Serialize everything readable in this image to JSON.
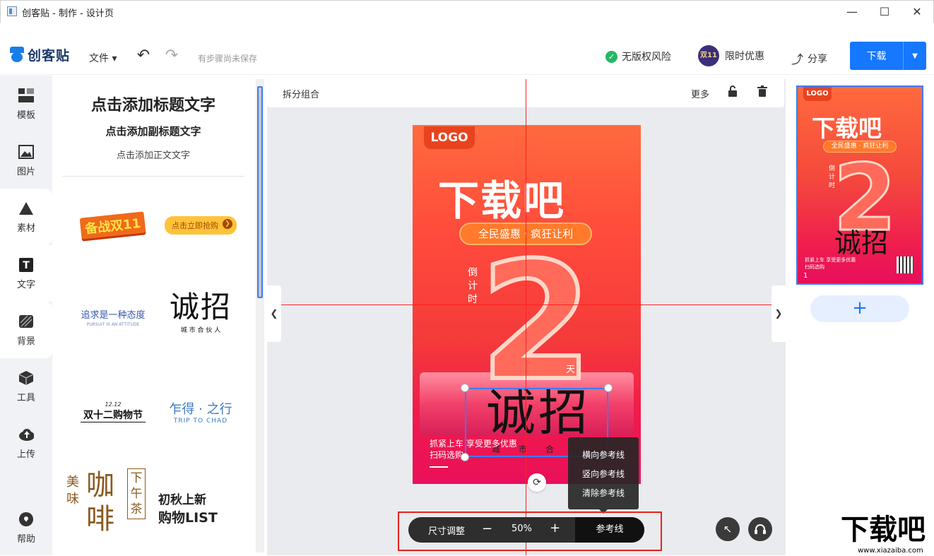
{
  "window": {
    "title": "创客贴 - 制作 - 设计页"
  },
  "header": {
    "brand": "创客贴",
    "file_menu": "文件 ▾",
    "save_status": "有步骤尚未保存",
    "no_copyright_risk": "无版权风险",
    "promo_badge": "双11",
    "promo": "限时优惠",
    "share": "分享",
    "download": "下载"
  },
  "sidebar": {
    "items": [
      {
        "label": "模板"
      },
      {
        "label": "图片"
      },
      {
        "label": "素材"
      },
      {
        "label": "文字"
      },
      {
        "label": "背景"
      },
      {
        "label": "工具"
      },
      {
        "label": "上传"
      },
      {
        "label": "帮助"
      }
    ]
  },
  "text_panel": {
    "title_text": "点击添加标题文字",
    "subtitle_text": "点击添加副标题文字",
    "body_text": "点击添加正文文字",
    "templates": [
      {
        "main": "备战双11",
        "sub": ""
      },
      {
        "main": "点击立即抢购",
        "sub": ""
      },
      {
        "main": "追求是一种态度",
        "sub": "PURSUIT IS AN ATTITUDE"
      },
      {
        "main": "诚招",
        "sub": "城 市 合 伙 人"
      },
      {
        "main": "双十二购物节",
        "sub": "12.12"
      },
      {
        "main": "乍得 · 之行",
        "sub": "TRIP TO CHAD"
      },
      {
        "main": "咖啡",
        "sub": "美味"
      },
      {
        "main": "下午茶",
        "sub": ""
      },
      {
        "main": "初秋上新",
        "sub": "购物LIST"
      }
    ]
  },
  "canvas_toolbar": {
    "split_group": "拆分组合",
    "more": "更多"
  },
  "poster": {
    "logo": "LOGO",
    "headline": "下载吧",
    "pill": "全民盛惠 · 疯狂让利",
    "countdown_label": "倒计时",
    "number": "2",
    "day": "天",
    "recruit": "诚招",
    "recruit_sub": "城市合伙",
    "cta_line1": "抓紧上车 享受更多优惠",
    "cta_line2": "扫码选购"
  },
  "context_menu": {
    "items": [
      "横向参考线",
      "竖向参考线",
      "清除参考线"
    ]
  },
  "zoom_bar": {
    "size_adjust": "尺寸调整",
    "minus": "−",
    "zoom": "50%",
    "plus": "+",
    "guides": "参考线"
  },
  "pages_panel": {
    "thumb_logo": "LOGO",
    "thumb_headline": "下载吧",
    "thumb_pill": "全民盛惠 · 疯狂让利",
    "thumb_countdown": "倒计时",
    "thumb_number": "2",
    "thumb_recruit": "诚招",
    "thumb_cta": "抓紧上车 享受更多优惠",
    "thumb_cta2": "扫码选购",
    "page_number": "1",
    "add_page": "+"
  },
  "watermark": {
    "big": "下载吧",
    "small": "www.xiazaiba.com"
  },
  "colors": {
    "accent": "#1677ff",
    "guide": "#ff2222",
    "highlight_frame": "#e5231c"
  }
}
